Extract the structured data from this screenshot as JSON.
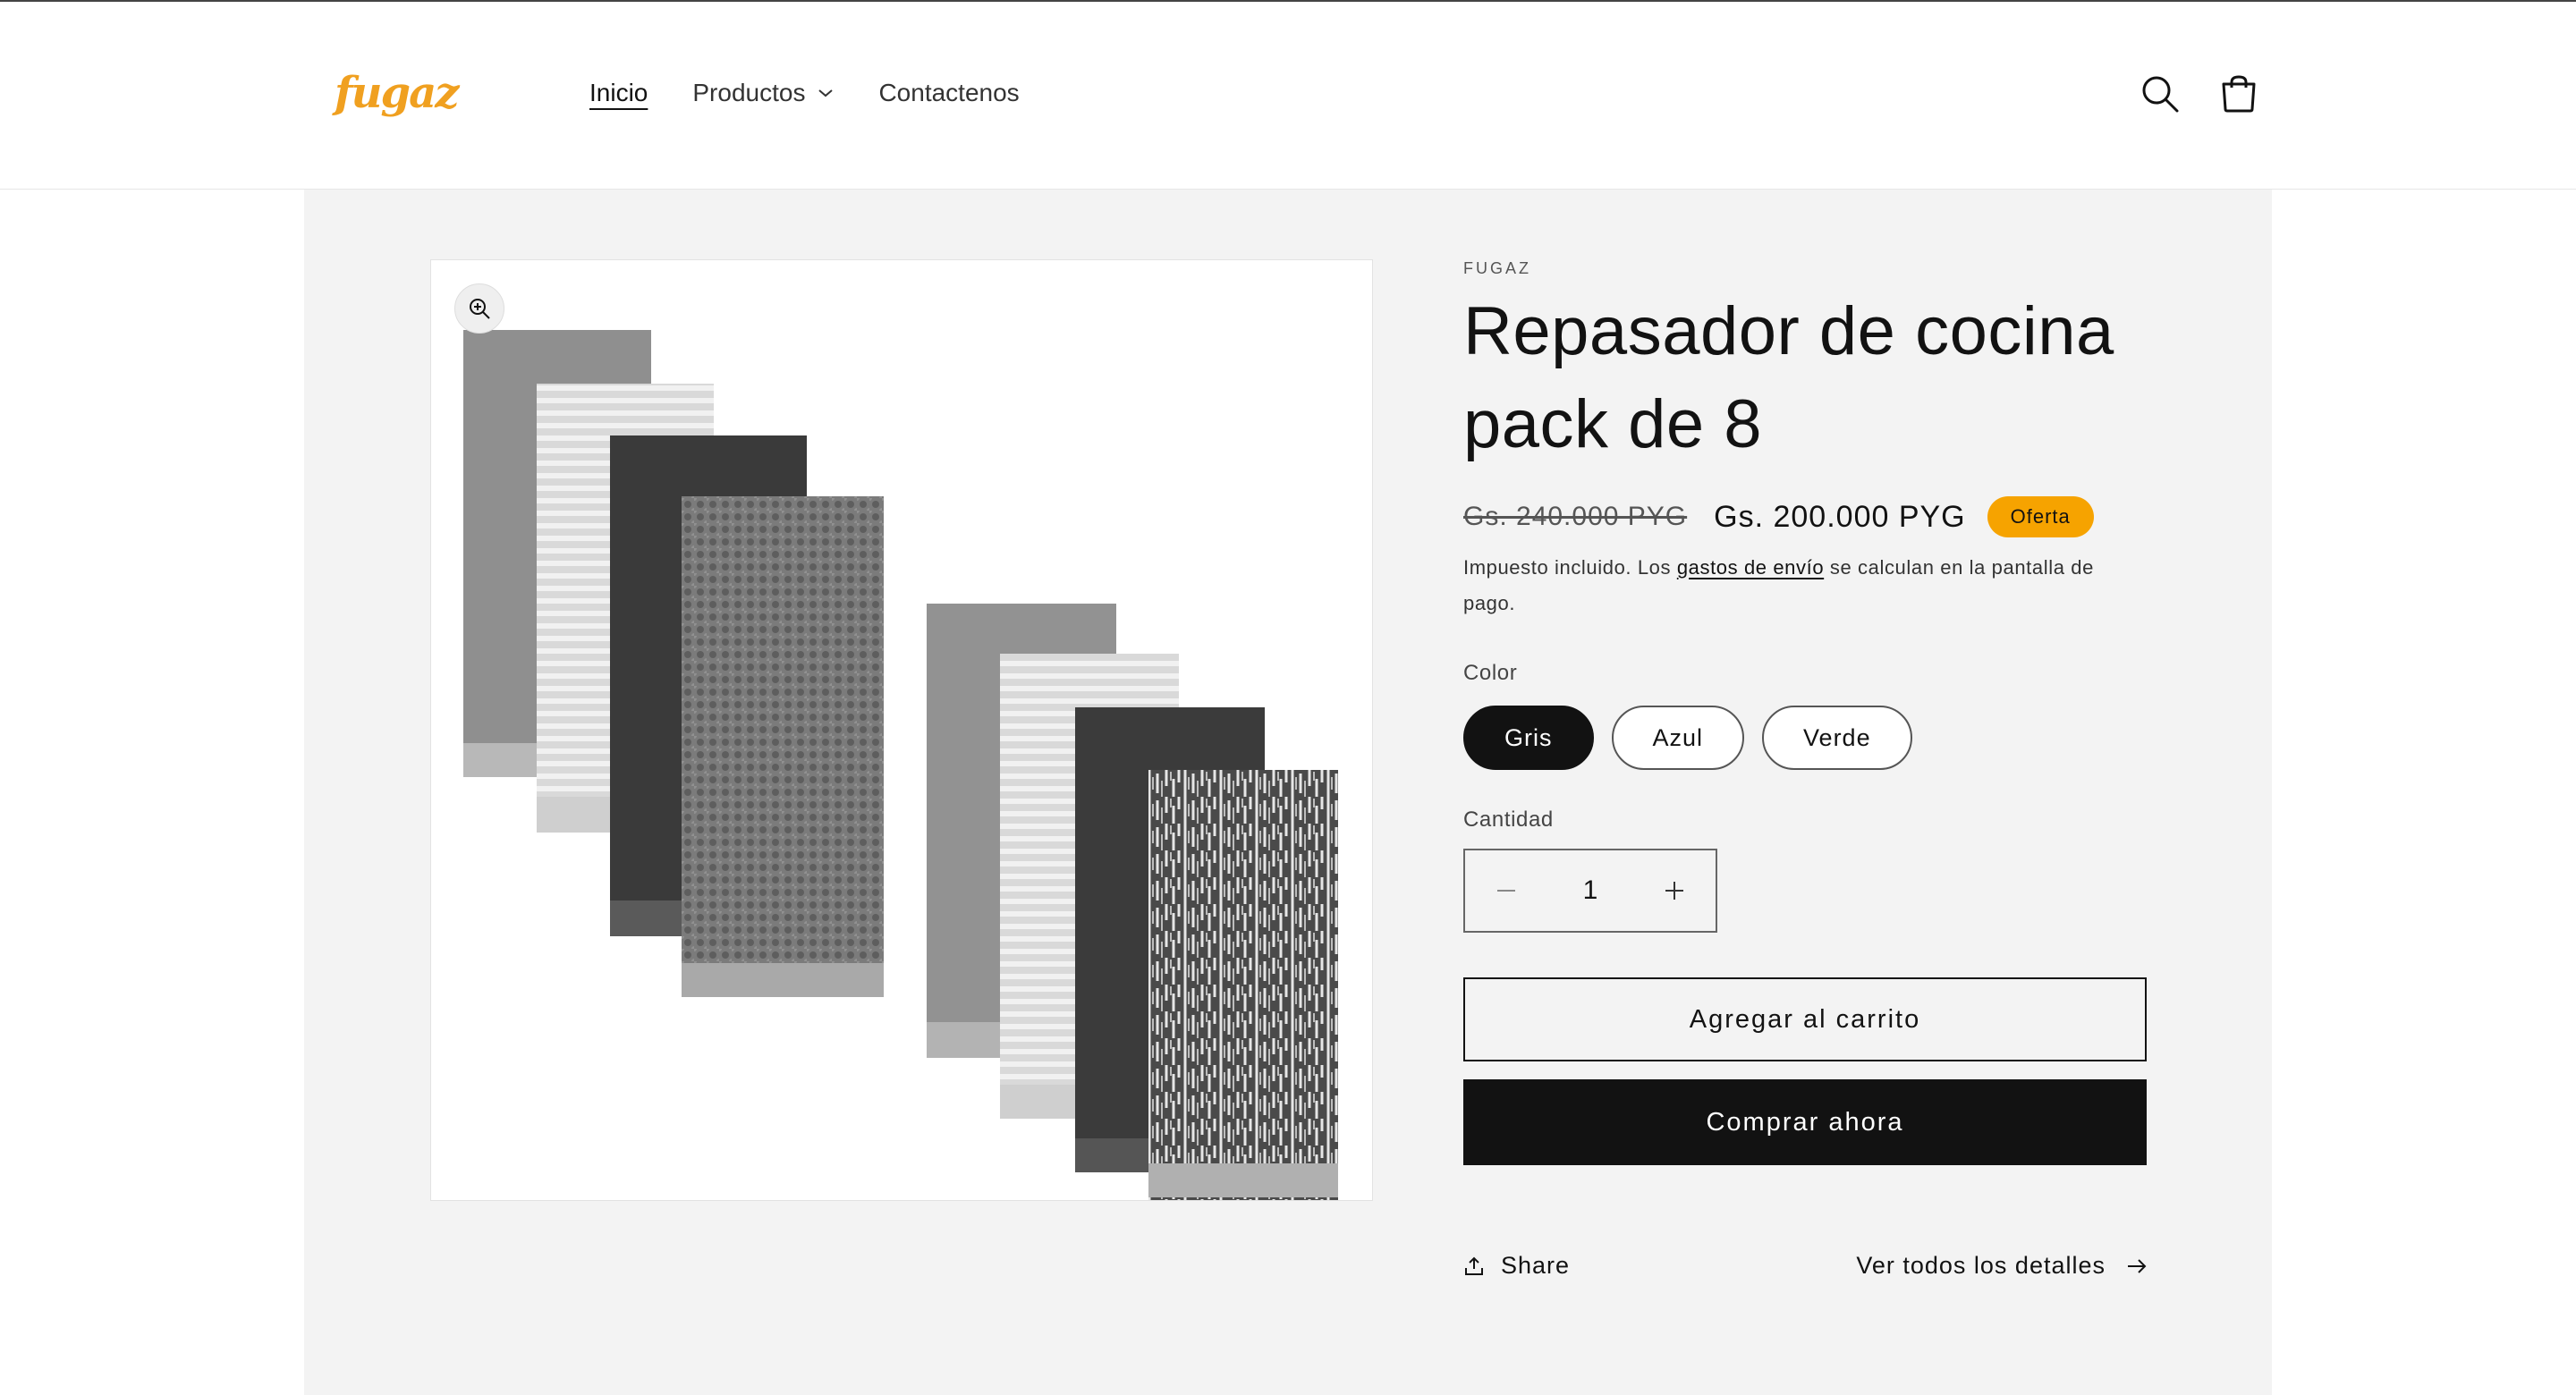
{
  "header": {
    "logo": "fugaz",
    "nav": [
      {
        "label": "Inicio"
      },
      {
        "label": "Productos"
      },
      {
        "label": "Contactenos"
      }
    ]
  },
  "product": {
    "vendor": "FUGAZ",
    "title": "Repasador de cocina pack de 8",
    "price_old": "Gs. 240.000 PYG",
    "price_new": "Gs. 200.000 PYG",
    "badge": "Oferta",
    "tax_before": "Impuesto incluido. Los ",
    "tax_link": "gastos de envío",
    "tax_after": " se calculan en la pantalla de pago.",
    "color_label": "Color",
    "colors": [
      "Gris",
      "Azul",
      "Verde"
    ],
    "selected_color": "Gris",
    "quantity_label": "Cantidad",
    "quantity": "1",
    "add_to_cart": "Agregar al carrito",
    "buy_now": "Comprar ahora",
    "share": "Share",
    "details": "Ver todos los detalles"
  },
  "colors": {
    "accent": "#f6a300",
    "logo": "#f0a020",
    "dark": "#121212",
    "page_bg": "#f3f3f3"
  },
  "icons": {
    "zoom": "zoom-in-icon",
    "search": "search-icon",
    "cart": "cart-icon",
    "share": "share-icon",
    "arrow": "arrow-right-icon",
    "chevron": "chevron-down-icon"
  }
}
